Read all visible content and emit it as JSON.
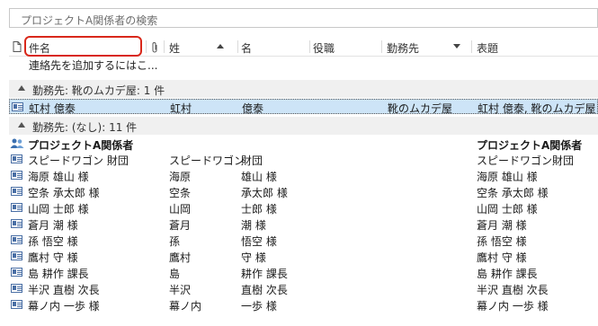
{
  "search": {
    "placeholder": "プロジェクトA関係者の検索"
  },
  "columns": {
    "subject": "件名",
    "last": "姓",
    "first": "名",
    "position": "役職",
    "company": "勤務先",
    "title": "表題"
  },
  "add_contact_text": "連絡先を追加するにはこ...",
  "groups": [
    {
      "label": "勤務先: 靴のムカデ屋: 1 件"
    },
    {
      "label": "勤務先: (なし): 11 件"
    }
  ],
  "rows": [
    {
      "name": "虹村 億泰",
      "last": "虹村",
      "first": "億泰",
      "company": "靴のムカデ屋",
      "title": "虹村 億泰, 靴のムカデ屋"
    },
    {
      "name": "プロジェクトA関係者",
      "last": "",
      "first": "",
      "company": "",
      "title": "プロジェクトA関係者"
    },
    {
      "name": "スピードワゴン 財団",
      "last": "スピードワゴン",
      "first": "財団",
      "company": "",
      "title": "スピードワゴン財団"
    },
    {
      "name": "海原 雄山 様",
      "last": "海原",
      "first": "雄山 様",
      "company": "",
      "title": "海原 雄山 様"
    },
    {
      "name": "空条 承太郎 様",
      "last": "空条",
      "first": "承太郎 様",
      "company": "",
      "title": "空条 承太郎 様"
    },
    {
      "name": "山岡 士郎 様",
      "last": "山岡",
      "first": "士郎 様",
      "company": "",
      "title": "山岡 士郎 様"
    },
    {
      "name": "蒼月 潮 様",
      "last": "蒼月",
      "first": "潮 様",
      "company": "",
      "title": "蒼月 潮 様"
    },
    {
      "name": "孫 悟空 様",
      "last": "孫",
      "first": "悟空 様",
      "company": "",
      "title": "孫 悟空 様"
    },
    {
      "name": "鷹村 守 様",
      "last": "鷹村",
      "first": "守 様",
      "company": "",
      "title": "鷹村 守 様"
    },
    {
      "name": "島 耕作 課長",
      "last": "島",
      "first": "耕作 課長",
      "company": "",
      "title": "島 耕作 課長"
    },
    {
      "name": "半沢 直樹 次長",
      "last": "半沢",
      "first": "直樹 次長",
      "company": "",
      "title": "半沢 直樹 次長"
    },
    {
      "name": "幕ノ内 一歩 様",
      "last": "幕ノ内",
      "first": "一歩 様",
      "company": "",
      "title": "幕ノ内 一歩 様"
    }
  ]
}
